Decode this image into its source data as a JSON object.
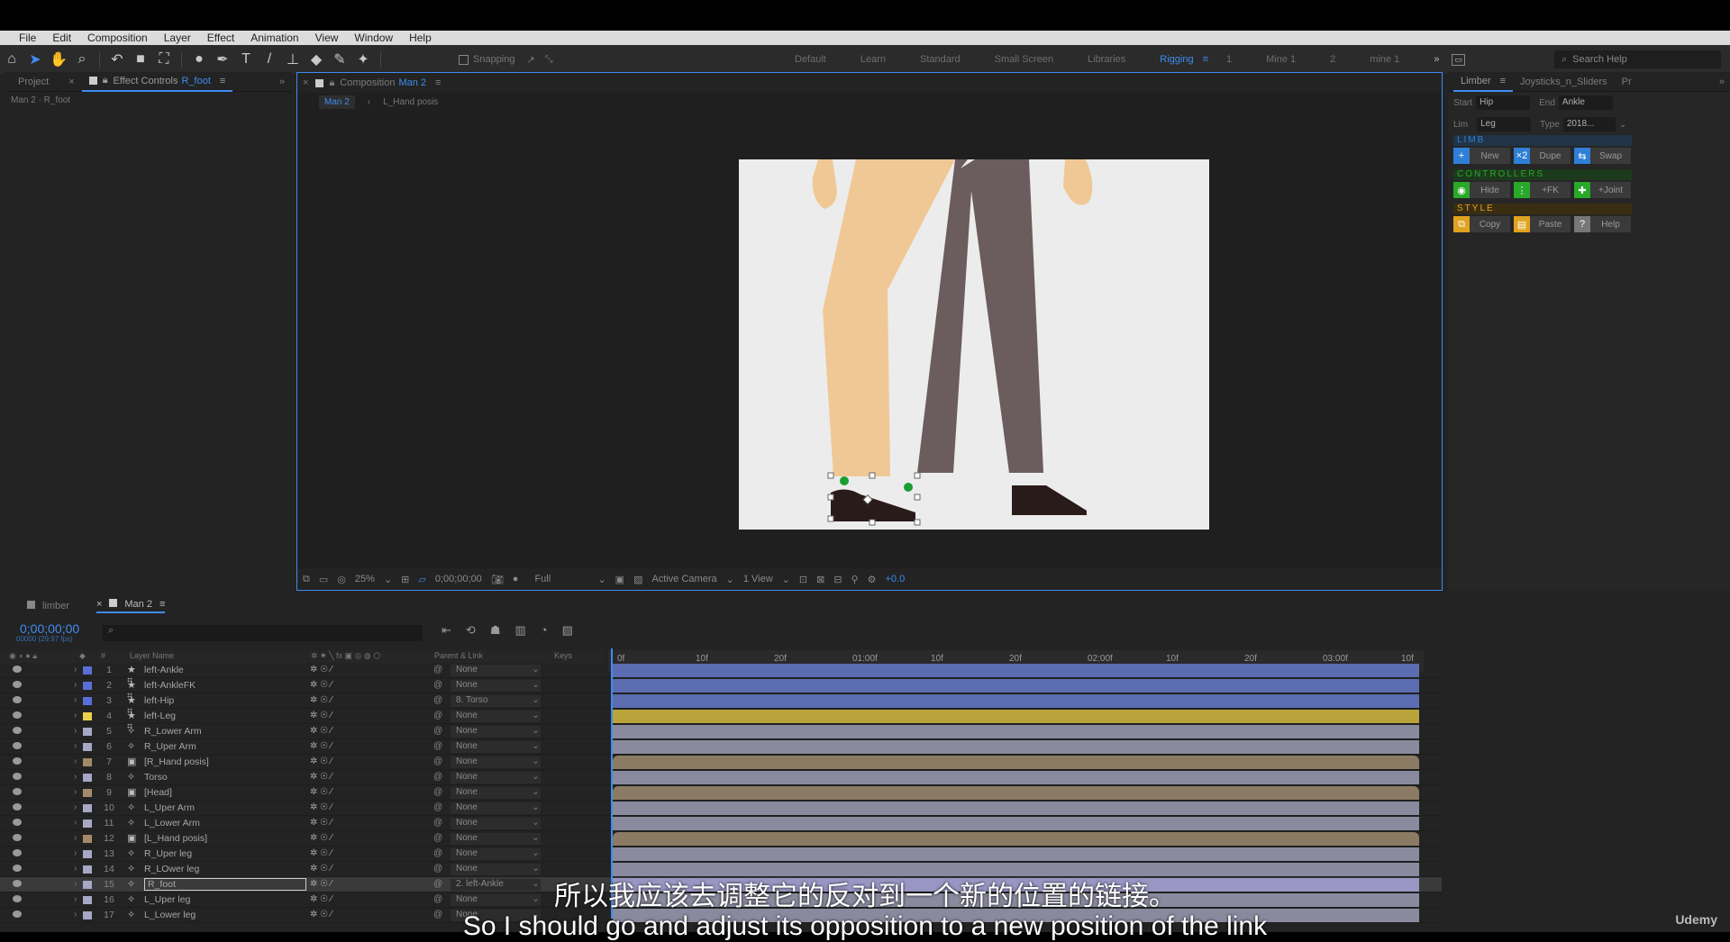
{
  "menu": [
    "File",
    "Edit",
    "Composition",
    "Layer",
    "Effect",
    "Animation",
    "View",
    "Window",
    "Help"
  ],
  "toolbar": {
    "snapping": "Snapping"
  },
  "workspaces": [
    "Default",
    "Learn",
    "Standard",
    "Small Screen",
    "Libraries",
    "Rigging",
    "1",
    "Mine 1",
    "2",
    "mine 1"
  ],
  "search_help": "Search Help",
  "left_panel": {
    "tab_project": "Project",
    "tab_effect": "Effect Controls",
    "tab_effect_layer": "R_foot",
    "path": "Man 2 · R_foot"
  },
  "viewer": {
    "tab_label": "Composition",
    "tab_comp": "Man 2",
    "breadcrumb_1": "Man 2",
    "breadcrumb_2": "L_Hand posis",
    "zoom": "25%",
    "time": "0;00;00;00",
    "quality": "Full",
    "camera": "Active Camera",
    "views": "1 View",
    "exposure": "+0.0"
  },
  "right_panel": {
    "tab_limber": "Limber",
    "tab_joysticks": "Joysticks_n_Sliders",
    "tab_pr": "Pr",
    "start_label": "Start",
    "start_value": "Hip",
    "end_label": "End",
    "end_value": "Ankle",
    "lim_label": "Lim",
    "lim_value": "Leg",
    "type_label": "Type",
    "type_value": "2018...",
    "section_limb": "LIMB",
    "section_controllers": "CONTROLLERS",
    "section_style": "STYLE",
    "btn_new": "New",
    "btn_dupe": "Dupe",
    "btn_swap": "Swap",
    "btn_hide": "Hide",
    "btn_fk": "+FK",
    "btn_joint": "+Joint",
    "btn_copy": "Copy",
    "btn_paste": "Paste",
    "btn_help": "Help",
    "colors": {
      "blue": "#2f7fd6",
      "green": "#29a829",
      "orange": "#e0a21f"
    }
  },
  "timeline": {
    "tab_limber": "limber",
    "tab_man2": "Man 2",
    "timecode": "0;00;00;00",
    "fps": "00000 (29.97 fps)",
    "col_layer": "Layer Name",
    "col_parent": "Parent & Link",
    "col_keys": "Keys",
    "ruler": [
      "0f",
      "10f",
      "20f",
      "01:00f",
      "10f",
      "20f",
      "02:00f",
      "10f",
      "20f",
      "03:00f",
      "10f"
    ],
    "layers": [
      {
        "num": "1",
        "name": "left-Ankle",
        "parent": "None",
        "color": "#5a6fd6",
        "type": "star",
        "bar": "#5b6db0"
      },
      {
        "num": "2",
        "name": "left-AnkleFK",
        "parent": "None",
        "color": "#5a6fd6",
        "type": "star",
        "bar": "#5b6db0"
      },
      {
        "num": "3",
        "name": "left-Hip",
        "parent": "8. Torso",
        "color": "#5a6fd6",
        "type": "star",
        "bar": "#5b6db0"
      },
      {
        "num": "4",
        "name": "left-Leg",
        "parent": "None",
        "color": "#e8d24a",
        "type": "star",
        "bar": "#b8a43a"
      },
      {
        "num": "5",
        "name": "R_Lower Arm",
        "parent": "None",
        "color": "#a7a7c6",
        "type": "shape",
        "bar": "#8a8a9f"
      },
      {
        "num": "6",
        "name": "R_Uper Arm",
        "parent": "None",
        "color": "#a7a7c6",
        "type": "shape",
        "bar": "#8a8a9f"
      },
      {
        "num": "7",
        "name": "[R_Hand posis]",
        "parent": "None",
        "color": "#a58a6a",
        "type": "comp",
        "bar": "#8c7b64"
      },
      {
        "num": "8",
        "name": "Torso",
        "parent": "None",
        "color": "#a7a7c6",
        "type": "shape",
        "bar": "#8a8a9f"
      },
      {
        "num": "9",
        "name": "[Head]",
        "parent": "None",
        "color": "#a58a6a",
        "type": "comp",
        "bar": "#8c7b64"
      },
      {
        "num": "10",
        "name": "L_Uper Arm",
        "parent": "None",
        "color": "#a7a7c6",
        "type": "shape",
        "bar": "#8a8a9f"
      },
      {
        "num": "11",
        "name": "L_Lower Arm",
        "parent": "None",
        "color": "#a7a7c6",
        "type": "shape",
        "bar": "#8a8a9f"
      },
      {
        "num": "12",
        "name": "[L_Hand posis]",
        "parent": "None",
        "color": "#a58a6a",
        "type": "comp",
        "bar": "#8c7b64"
      },
      {
        "num": "13",
        "name": "R_Uper leg",
        "parent": "None",
        "color": "#a7a7c6",
        "type": "shape",
        "bar": "#8a8a9f"
      },
      {
        "num": "14",
        "name": "R_LOwer leg",
        "parent": "None",
        "color": "#a7a7c6",
        "type": "shape",
        "bar": "#8a8a9f"
      },
      {
        "num": "15",
        "name": "R_foot",
        "parent": "2. left-Ankle",
        "color": "#a7a7c6",
        "type": "shape",
        "bar": "#9a96c4"
      },
      {
        "num": "16",
        "name": "L_Uper leg",
        "parent": "None",
        "color": "#a7a7c6",
        "type": "shape",
        "bar": "#8a8a9f"
      },
      {
        "num": "17",
        "name": "L_Lower leg",
        "parent": "None",
        "color": "#a7a7c6",
        "type": "shape",
        "bar": "#8a8a9f"
      }
    ]
  },
  "subtitles": {
    "zh": "所以我应该去调整它的反对到一个新的位置的链接。",
    "en": "So I should go and adjust its opposition to a new position of the link"
  },
  "watermark": "Udemy"
}
